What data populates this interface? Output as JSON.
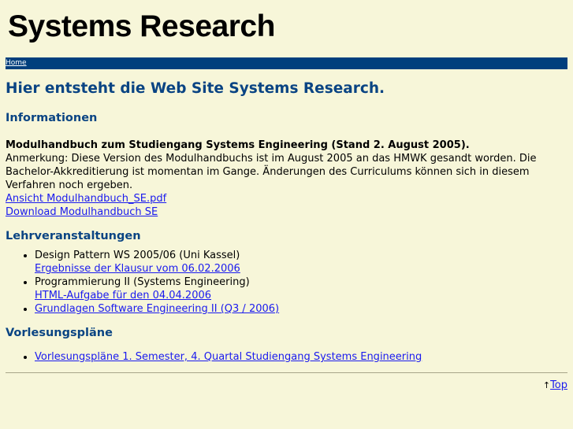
{
  "site_title": "Systems Research",
  "nav": {
    "home": "Home"
  },
  "heading": "Hier entsteht die Web Site Systems Research.",
  "informationen": {
    "title": "Informationen",
    "bold": "Modulhandbuch zum Studiengang Systems Engineering (Stand 2. August 2005).",
    "note": "Anmerkung: Diese Version des Modulhandbuchs ist im August 2005 an das HMWK gesandt worden. Die Bachelor-Akkreditierung ist momentan im Gange. Änderungen des Curriculums können sich in diesem Verfahren noch ergeben.",
    "link1": "Ansicht Modulhandbuch_SE.pdf",
    "link2": "Download Modulhandbuch SE"
  },
  "lehr": {
    "title": "Lehrveranstaltungen",
    "items": [
      {
        "text": "Design Pattern WS 2005/06 (Uni Kassel)",
        "link": "Ergebnisse der Klausur vom 06.02.2006"
      },
      {
        "text": "Programmierung II (Systems Engineering)",
        "link": "HTML-Aufgabe für den 04.04.2006"
      },
      {
        "link": "Grundlagen Software Engineering II (Q3 / 2006)"
      }
    ]
  },
  "vorl": {
    "title": "Vorlesungspläne",
    "items": [
      {
        "link": "Vorlesungspläne 1. Semester, 4. Quartal Studiengang Systems Engineering"
      }
    ]
  },
  "footer": {
    "arrow": "↑",
    "top": "Top"
  }
}
